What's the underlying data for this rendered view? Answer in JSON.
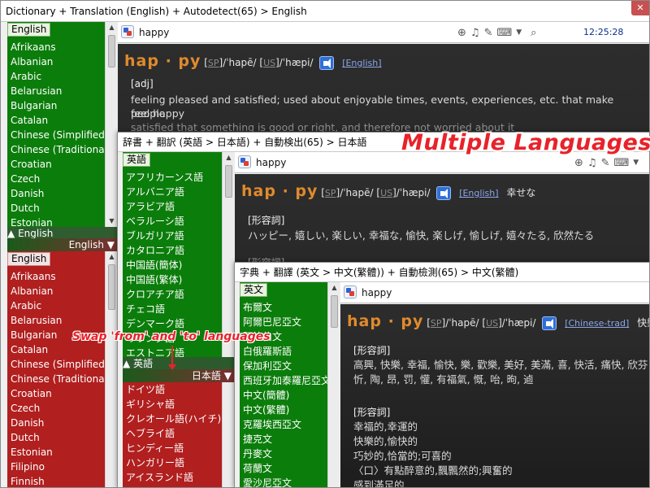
{
  "win1": {
    "title": "Dictionary + Translation (English) + Autodetect(65) > English",
    "from_selected": "English",
    "from_languages": [
      "Afrikaans",
      "Albanian",
      "Arabic",
      "Belarusian",
      "Bulgarian",
      "Catalan",
      "Chinese (Simplified)",
      "Chinese (Traditional)",
      "Croatian",
      "Czech",
      "Danish",
      "Dutch",
      "Estonian"
    ],
    "from_label": "English",
    "to_label": "English",
    "to_selected": "English",
    "to_languages": [
      "Afrikaans",
      "Albanian",
      "Arabic",
      "Belarusian",
      "Bulgarian",
      "Catalan",
      "Chinese (Simplified)",
      "Chinese (Traditional)",
      "Croatian",
      "Czech",
      "Danish",
      "Dutch",
      "Estonian",
      "Filipino",
      "Finnish"
    ],
    "query": "happy",
    "time": "12:25:28",
    "headword": "hap · py",
    "pron_sp_tag": "SP",
    "pron_sp": "/ˈhapē/",
    "pron_us_tag": "US",
    "pron_us": "/ˈhæpi/",
    "source": "English",
    "pos": "[adj]",
    "def_1": "feeling pleased and satisfied; used about enjoyable times, events, experiences, etc. that make people",
    "def_2": "feel happy",
    "def_3": "satisfied that something is good or right, and therefore not worried about it"
  },
  "win2": {
    "title": "辞書 + 翻訳 (英語 > 日本語) + 自動検出(65) > 日本語",
    "from_selected": "英語",
    "from_languages": [
      "アフリカーンス語",
      "アルバニア語",
      "アラビア語",
      "ベラルーシ語",
      "ブルガリア語",
      "カタロニア語",
      "中国語(簡体)",
      "中国語(繁体)",
      "クロアチア語",
      "チェコ語",
      "デンマーク語",
      "オランダ語",
      "エストニア語"
    ],
    "from_label": "英語",
    "to_label": "日本語",
    "to_languages": [
      "ドイツ語",
      "ギリシャ語",
      "クレオール語(ハイチ)",
      "ヘブライ語",
      "ヒンディー語",
      "ハンガリー語",
      "アイスランド語"
    ],
    "query": "happy",
    "headword": "hap · py",
    "pron_sp_tag": "SP",
    "pron_sp": "/ˈhapē/",
    "pron_us_tag": "US",
    "pron_us": "/ˈhæpi/",
    "source": "English",
    "translation": "幸せな",
    "pos": "[形容詞]",
    "def_1": "ハッピー, 嬉しい, 楽しい, 幸福な, 愉快, 楽しげ, 愉しげ, 嬉々たる, 欣然たる",
    "pos_2": "[形容詞]"
  },
  "win3": {
    "title": "字典 + 翻譯 (英文 > 中文(繁體)) + 自動檢測(65) > 中文(繁體)",
    "from_selected": "英文",
    "from_languages": [
      "布爾文",
      "阿爾巴尼亞文",
      "阿拉伯文",
      "白俄羅斯語",
      "保加利亞文",
      "西班牙加泰羅尼亞文",
      "中文(簡體)",
      "中文(繁體)",
      "克羅埃西亞文",
      "捷克文",
      "丹麥文",
      "荷蘭文",
      "愛沙尼亞文"
    ],
    "query": "happy",
    "headword": "hap · py",
    "pron_sp_tag": "SP",
    "pron_sp": "/ˈhapē/",
    "pron_us_tag": "US",
    "pron_us": "/ˈhæpi/",
    "source": "Chinese-trad",
    "translation": "快樂",
    "pos_1": "[形容詞]",
    "def_1a": "高興, 快樂, 幸福, 愉快, 樂, 歡樂, 美好, 美滿, 喜, 快活, 痛快, 欣芬",
    "def_1b": "忻, 陶, 昂, 罚, 懽, 有福氣, 慨, 咍, 昫, 逌",
    "pos_2": "[形容詞]",
    "def_2a": "幸福的,幸運的",
    "def_2b": "快樂的,愉快的",
    "def_2c": "巧妙的,恰當的;可喜的",
    "def_2d": "〈口〉有點醉意的,飄飄然的;興奮的",
    "def_2e": "感到滿足的"
  },
  "callouts": {
    "multi": "Multiple Languages",
    "swap": "Swap 'from' and 'to' languages"
  },
  "icons": [
    "logo-icon",
    "lifebuoy-icon",
    "bell-icon",
    "pen-icon",
    "keyboard-icon",
    "dropdown-icon",
    "search-icon",
    "close-icon",
    "speaker-icon",
    "collapse-arrow-icon"
  ]
}
